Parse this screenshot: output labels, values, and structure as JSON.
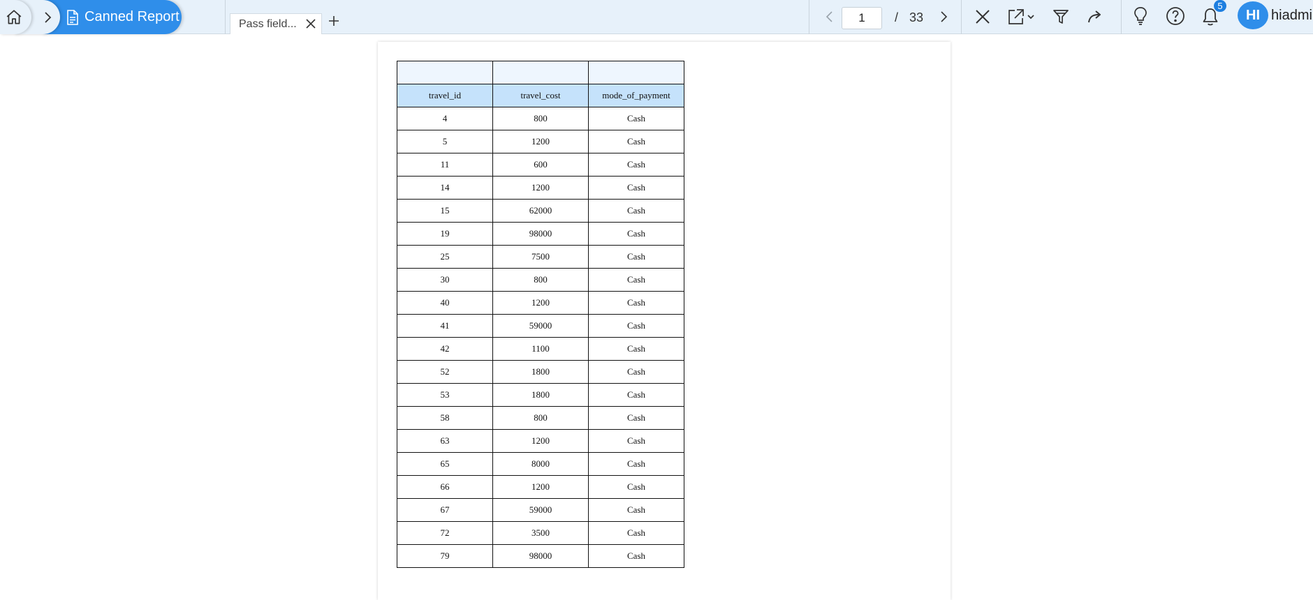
{
  "breadcrumb": {
    "report_title": "Canned Report"
  },
  "tabs": [
    {
      "label": "Pass field..."
    }
  ],
  "pager": {
    "current_page": "1",
    "separator": "/",
    "total_pages": "33"
  },
  "notifications": {
    "count": "5"
  },
  "user": {
    "initials": "HI",
    "name": "hiadmin"
  },
  "report_table": {
    "columns": [
      "travel_id",
      "travel_cost",
      "mode_of_payment"
    ],
    "rows": [
      [
        "4",
        "800",
        "Cash"
      ],
      [
        "5",
        "1200",
        "Cash"
      ],
      [
        "11",
        "600",
        "Cash"
      ],
      [
        "14",
        "1200",
        "Cash"
      ],
      [
        "15",
        "62000",
        "Cash"
      ],
      [
        "19",
        "98000",
        "Cash"
      ],
      [
        "25",
        "7500",
        "Cash"
      ],
      [
        "30",
        "800",
        "Cash"
      ],
      [
        "40",
        "1200",
        "Cash"
      ],
      [
        "41",
        "59000",
        "Cash"
      ],
      [
        "42",
        "1100",
        "Cash"
      ],
      [
        "52",
        "1800",
        "Cash"
      ],
      [
        "53",
        "1800",
        "Cash"
      ],
      [
        "58",
        "800",
        "Cash"
      ],
      [
        "63",
        "1200",
        "Cash"
      ],
      [
        "65",
        "8000",
        "Cash"
      ],
      [
        "66",
        "1200",
        "Cash"
      ],
      [
        "67",
        "59000",
        "Cash"
      ],
      [
        "72",
        "3500",
        "Cash"
      ],
      [
        "79",
        "98000",
        "Cash"
      ]
    ]
  },
  "colors": {
    "accent": "#2f8eea",
    "topbar_bg": "#e7f1fa",
    "header_cell_bg": "#c5e2fb",
    "group_cell_bg": "#eef6fe"
  }
}
